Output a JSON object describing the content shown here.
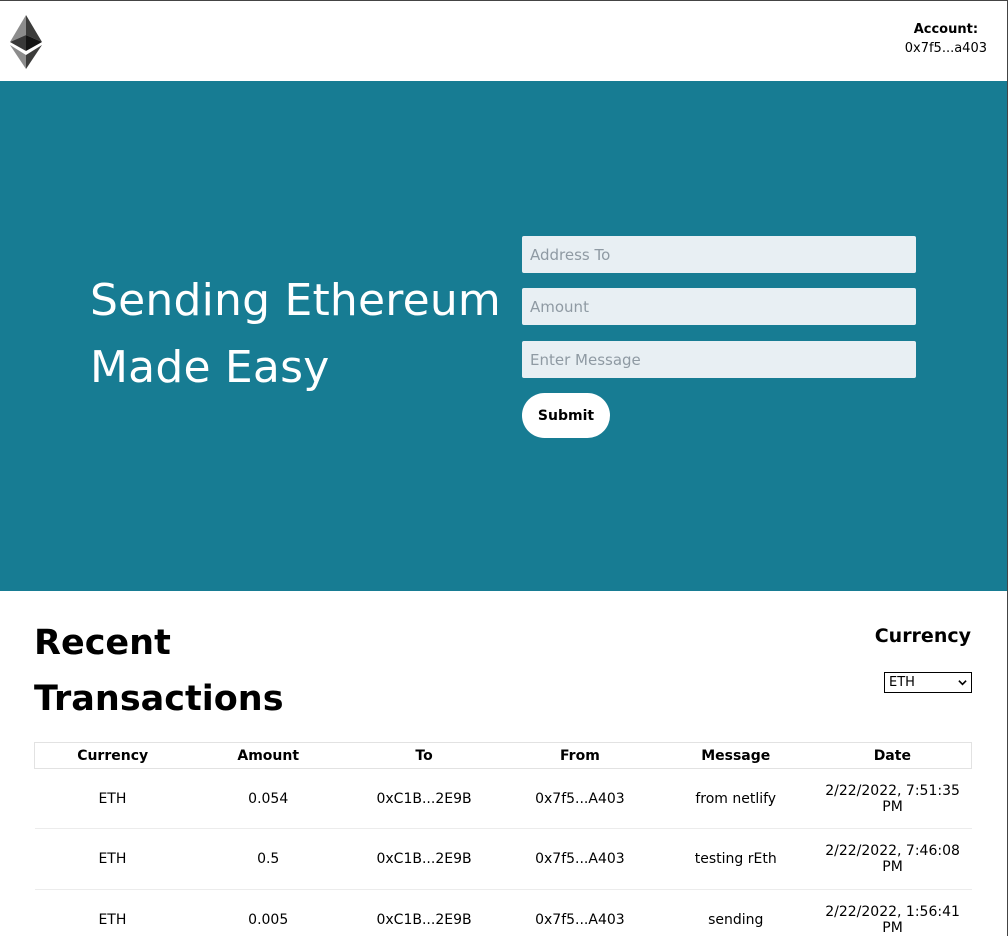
{
  "header": {
    "logo_icon": "ethereum-logo-icon",
    "account_label": "Account:",
    "account_value": "0x7f5...a403"
  },
  "hero": {
    "title_line1": "Sending Ethereum",
    "title_line2": "Made Easy",
    "background_color": "#177c93",
    "form": {
      "address_placeholder": "Address To",
      "amount_placeholder": "Amount",
      "message_placeholder": "Enter Message",
      "submit_label": "Submit"
    }
  },
  "recent": {
    "title_line1": "Recent",
    "title_line2": "Transactions",
    "currency_label": "Currency",
    "currency_selected": "ETH",
    "columns": [
      "Currency",
      "Amount",
      "To",
      "From",
      "Message",
      "Date"
    ],
    "rows": [
      {
        "currency": "ETH",
        "amount": "0.054",
        "to": "0xC1B...2E9B",
        "from": "0x7f5...A403",
        "message": "from netlify",
        "date": "2/22/2022, 7:51:35 PM"
      },
      {
        "currency": "ETH",
        "amount": "0.5",
        "to": "0xC1B...2E9B",
        "from": "0x7f5...A403",
        "message": "testing rEth",
        "date": "2/22/2022, 7:46:08 PM"
      },
      {
        "currency": "ETH",
        "amount": "0.005",
        "to": "0xC1B...2E9B",
        "from": "0x7f5...A403",
        "message": "sending",
        "date": "2/22/2022, 1:56:41 PM"
      }
    ]
  }
}
